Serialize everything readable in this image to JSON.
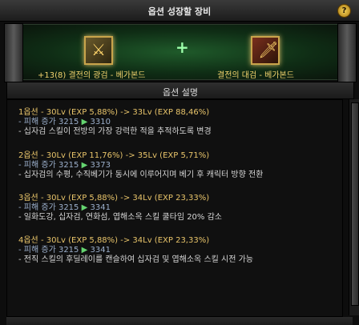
{
  "window": {
    "title": "옵션 성장할 장비",
    "help_label": "?"
  },
  "items": {
    "left_label": "+13(8) 결전의 광검 - 베가본드",
    "right_label": "결전의 대검 - 베가본드",
    "plus_label": "+"
  },
  "section": {
    "title": "옵션 설명"
  },
  "options": [
    {
      "title": "1옵션 - 30Lv (EXP 5,88%) -> 33Lv (EXP 88,46%)",
      "damage_prefix": "- 피해 증가 ",
      "damage_from": "3215",
      "arrow": "▶",
      "damage_to": "3310",
      "desc": "- 십자검 스킬이 전방의 가장 강력한 적을 추적하도록 변경"
    },
    {
      "title": "2옵션 - 30Lv (EXP 11,76%) -> 35Lv (EXP 5,71%)",
      "damage_prefix": "- 피해 증가 ",
      "damage_from": "3215",
      "arrow": "▶",
      "damage_to": "3373",
      "desc": "- 십자검의 수평, 수직베기가 동시에 이루어지며 베기 후 캐릭터 방향 전환"
    },
    {
      "title": "3옵션 - 30Lv (EXP 5,88%) -> 34Lv (EXP 23,33%)",
      "damage_prefix": "- 피해 증가 ",
      "damage_from": "3215",
      "arrow": "▶",
      "damage_to": "3341",
      "desc": "- 일화도강, 십자검, 연화섬, 엽해소옥 스킬 쿨타임 20% 감소"
    },
    {
      "title": "4옵션 - 30Lv (EXP 5,88%) -> 34Lv (EXP 23,33%)",
      "damage_prefix": "- 피해 증가 ",
      "damage_from": "3215",
      "arrow": "▶",
      "damage_to": "3341",
      "desc": "- 전직 스킬의 후딜레이를 캔슬하여 십자검 및 엽해소옥 스킬 시전 가능"
    }
  ],
  "colors": {
    "title": "#e8e8e8",
    "option_title": "#e8c46a",
    "arrow": "#65d470",
    "damage": "#9cb0cc"
  }
}
